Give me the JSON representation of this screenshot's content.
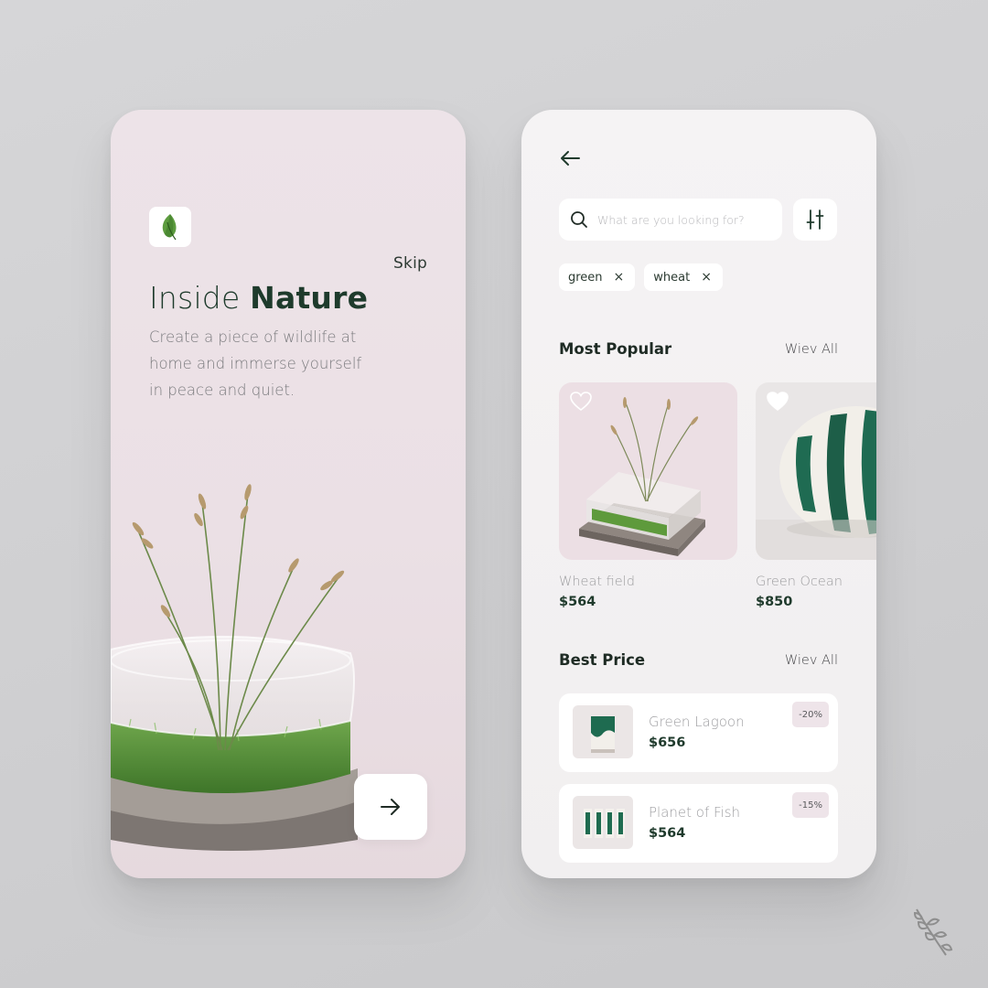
{
  "onboarding": {
    "skip_label": "Skip",
    "logo_icon": "leaf-icon",
    "title_light": "Inside ",
    "title_bold": "Nature",
    "description": "Create a piece of wildlife at home and immerse yourself in peace and quiet.",
    "next_icon": "arrow-right-icon"
  },
  "catalog": {
    "back_icon": "arrow-left-icon",
    "search": {
      "placeholder": "What are you looking for?",
      "value": ""
    },
    "filter_icon": "sliders-icon",
    "chips": [
      {
        "label": "green",
        "remove": "×"
      },
      {
        "label": "wheat",
        "remove": "×"
      }
    ],
    "most_popular": {
      "title": "Most Popular",
      "view_all": "Wiev All",
      "items": [
        {
          "name": "Wheat field",
          "price": "$564"
        },
        {
          "name": "Green Ocean",
          "price": "$850"
        }
      ]
    },
    "best_price": {
      "title": "Best Price",
      "view_all": "Wiev All",
      "items": [
        {
          "name": "Green Lagoon",
          "price": "$656",
          "discount": "-20%"
        },
        {
          "name": "Planet of Fish",
          "price": "$564",
          "discount": "-15%"
        }
      ]
    }
  },
  "colors": {
    "brand_green": "#1f3a2c",
    "leaf_green": "#5a9a3c",
    "left_bg": "#ece2e7",
    "right_bg": "#f4f2f3",
    "discount_bg": "#eee4e9"
  }
}
